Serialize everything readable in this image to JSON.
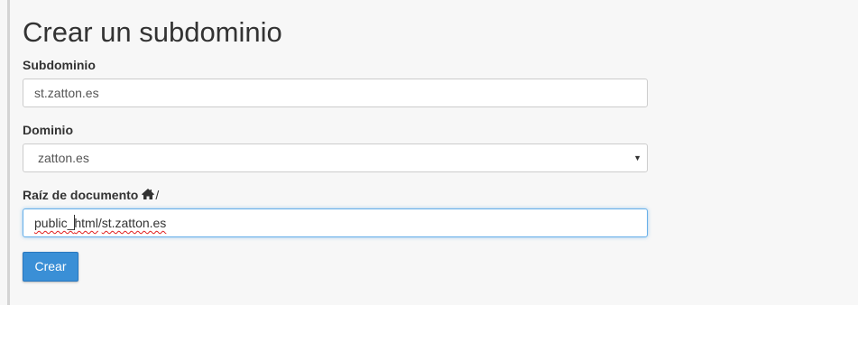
{
  "page": {
    "title": "Crear un subdominio"
  },
  "form": {
    "subdomain": {
      "label": "Subdominio",
      "value": "st.zatton.es"
    },
    "domain": {
      "label": "Dominio",
      "selected": "zatton.es",
      "caret_icon": "caret-down-icon"
    },
    "document_root": {
      "label": "Raíz de documento",
      "home_icon": "home-icon",
      "prefix_suffix": "/",
      "value_part1": "public_",
      "value_part2": "html",
      "value_part3": "/",
      "value_part4": "st.zatton.es"
    },
    "submit_label": "Crear"
  },
  "colors": {
    "panel_background": "#f7f7f7",
    "button_primary": "#3a8fd6",
    "focus_border": "#66afe9",
    "spellcheck_underline": "#e02020"
  }
}
